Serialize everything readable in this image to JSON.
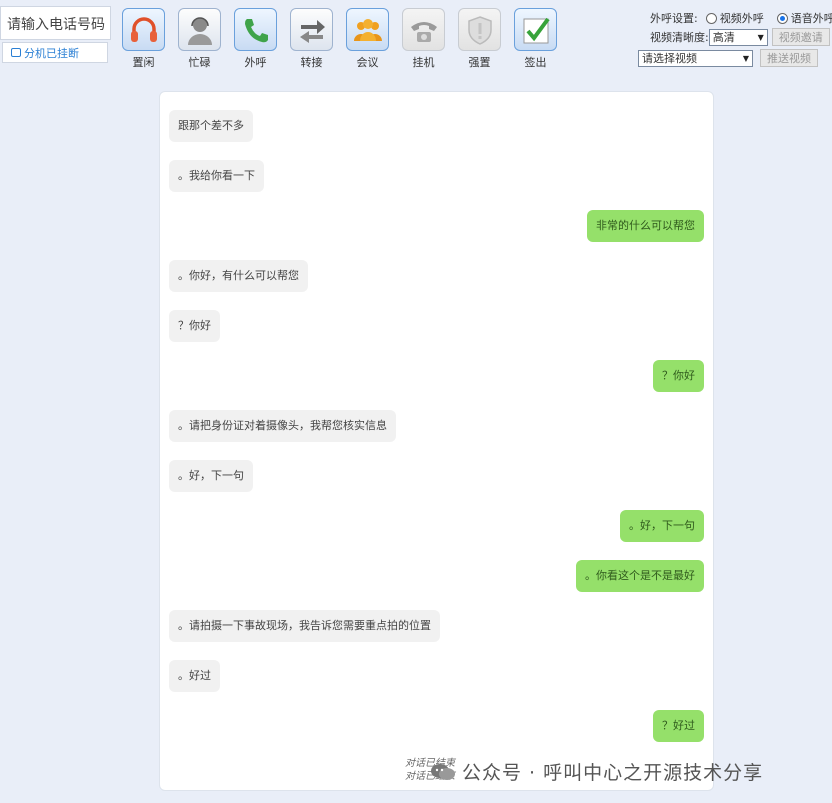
{
  "phone": {
    "placeholder": "请输入电话号码"
  },
  "extension_status": "分机已挂断",
  "toolbar": [
    {
      "label": "置闲",
      "icon": "headset-icon",
      "state": "active"
    },
    {
      "label": "忙碌",
      "icon": "agent-icon",
      "state": "normal"
    },
    {
      "label": "外呼",
      "icon": "phone-call-icon",
      "state": "active"
    },
    {
      "label": "转接",
      "icon": "transfer-icon",
      "state": "normal"
    },
    {
      "label": "会议",
      "icon": "conference-icon",
      "state": "active"
    },
    {
      "label": "挂机",
      "icon": "hangup-icon",
      "state": "disabled"
    },
    {
      "label": "强置",
      "icon": "shield-icon",
      "state": "disabled"
    },
    {
      "label": "签出",
      "icon": "checkmark-icon",
      "state": "active"
    }
  ],
  "settings": {
    "outbound_label": "外呼设置:",
    "radio_video": "视频外呼",
    "radio_voice": "语音外呼",
    "selected": "voice",
    "clarity_label": "视频清晰度:",
    "clarity_value": "高清",
    "invite_button": "视频邀请",
    "video_select": "请选择视频",
    "push_button": "推送视频"
  },
  "messages": [
    {
      "side": "in",
      "text": "跟那个差不多"
    },
    {
      "side": "in",
      "text": "。我给你看一下"
    },
    {
      "side": "out",
      "text": "非常的什么可以帮您"
    },
    {
      "side": "in",
      "text": "。你好，有什么可以帮您"
    },
    {
      "side": "in",
      "text": "？你好"
    },
    {
      "side": "out",
      "text": "？你好"
    },
    {
      "side": "in",
      "text": "。请把身份证对着摄像头，我帮您核实信息"
    },
    {
      "side": "in",
      "text": "。好，下一句"
    },
    {
      "side": "out",
      "text": "。好，下一句"
    },
    {
      "side": "out",
      "text": "。你看这个是不是最好"
    },
    {
      "side": "in",
      "text": "。请拍摄一下事故现场，我告诉您需要重点拍的位置"
    },
    {
      "side": "in",
      "text": "。好过"
    },
    {
      "side": "out",
      "text": "？好过"
    }
  ],
  "ended_lines": [
    "对话已结束",
    "对话已结束"
  ],
  "watermark": "公众号 · 呼叫中心之开源技术分享",
  "colors": {
    "outgoing_bubble": "#95e06a",
    "incoming_bubble": "#f1f1f1",
    "page_bg": "#e9eef8"
  }
}
